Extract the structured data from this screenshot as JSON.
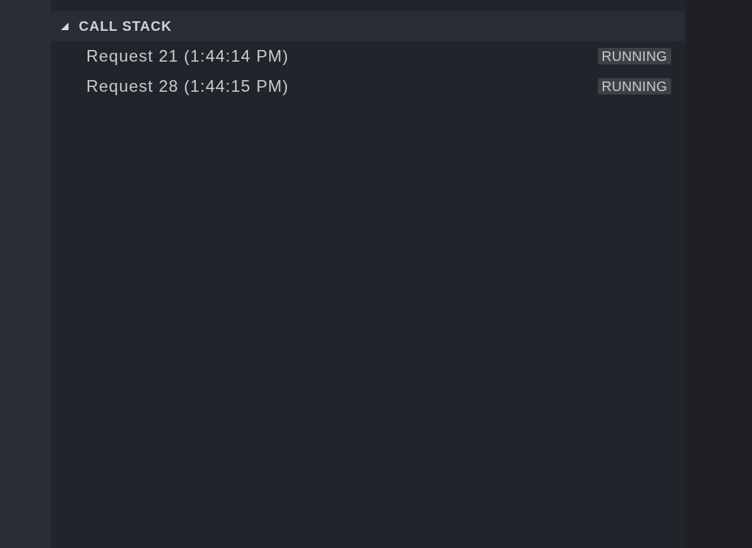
{
  "call_stack": {
    "title": "CALL STACK",
    "expanded": true,
    "items": [
      {
        "label": "Request 21 (1:44:14 PM)",
        "status": "RUNNING"
      },
      {
        "label": "Request 28 (1:44:15 PM)",
        "status": "RUNNING"
      }
    ]
  }
}
